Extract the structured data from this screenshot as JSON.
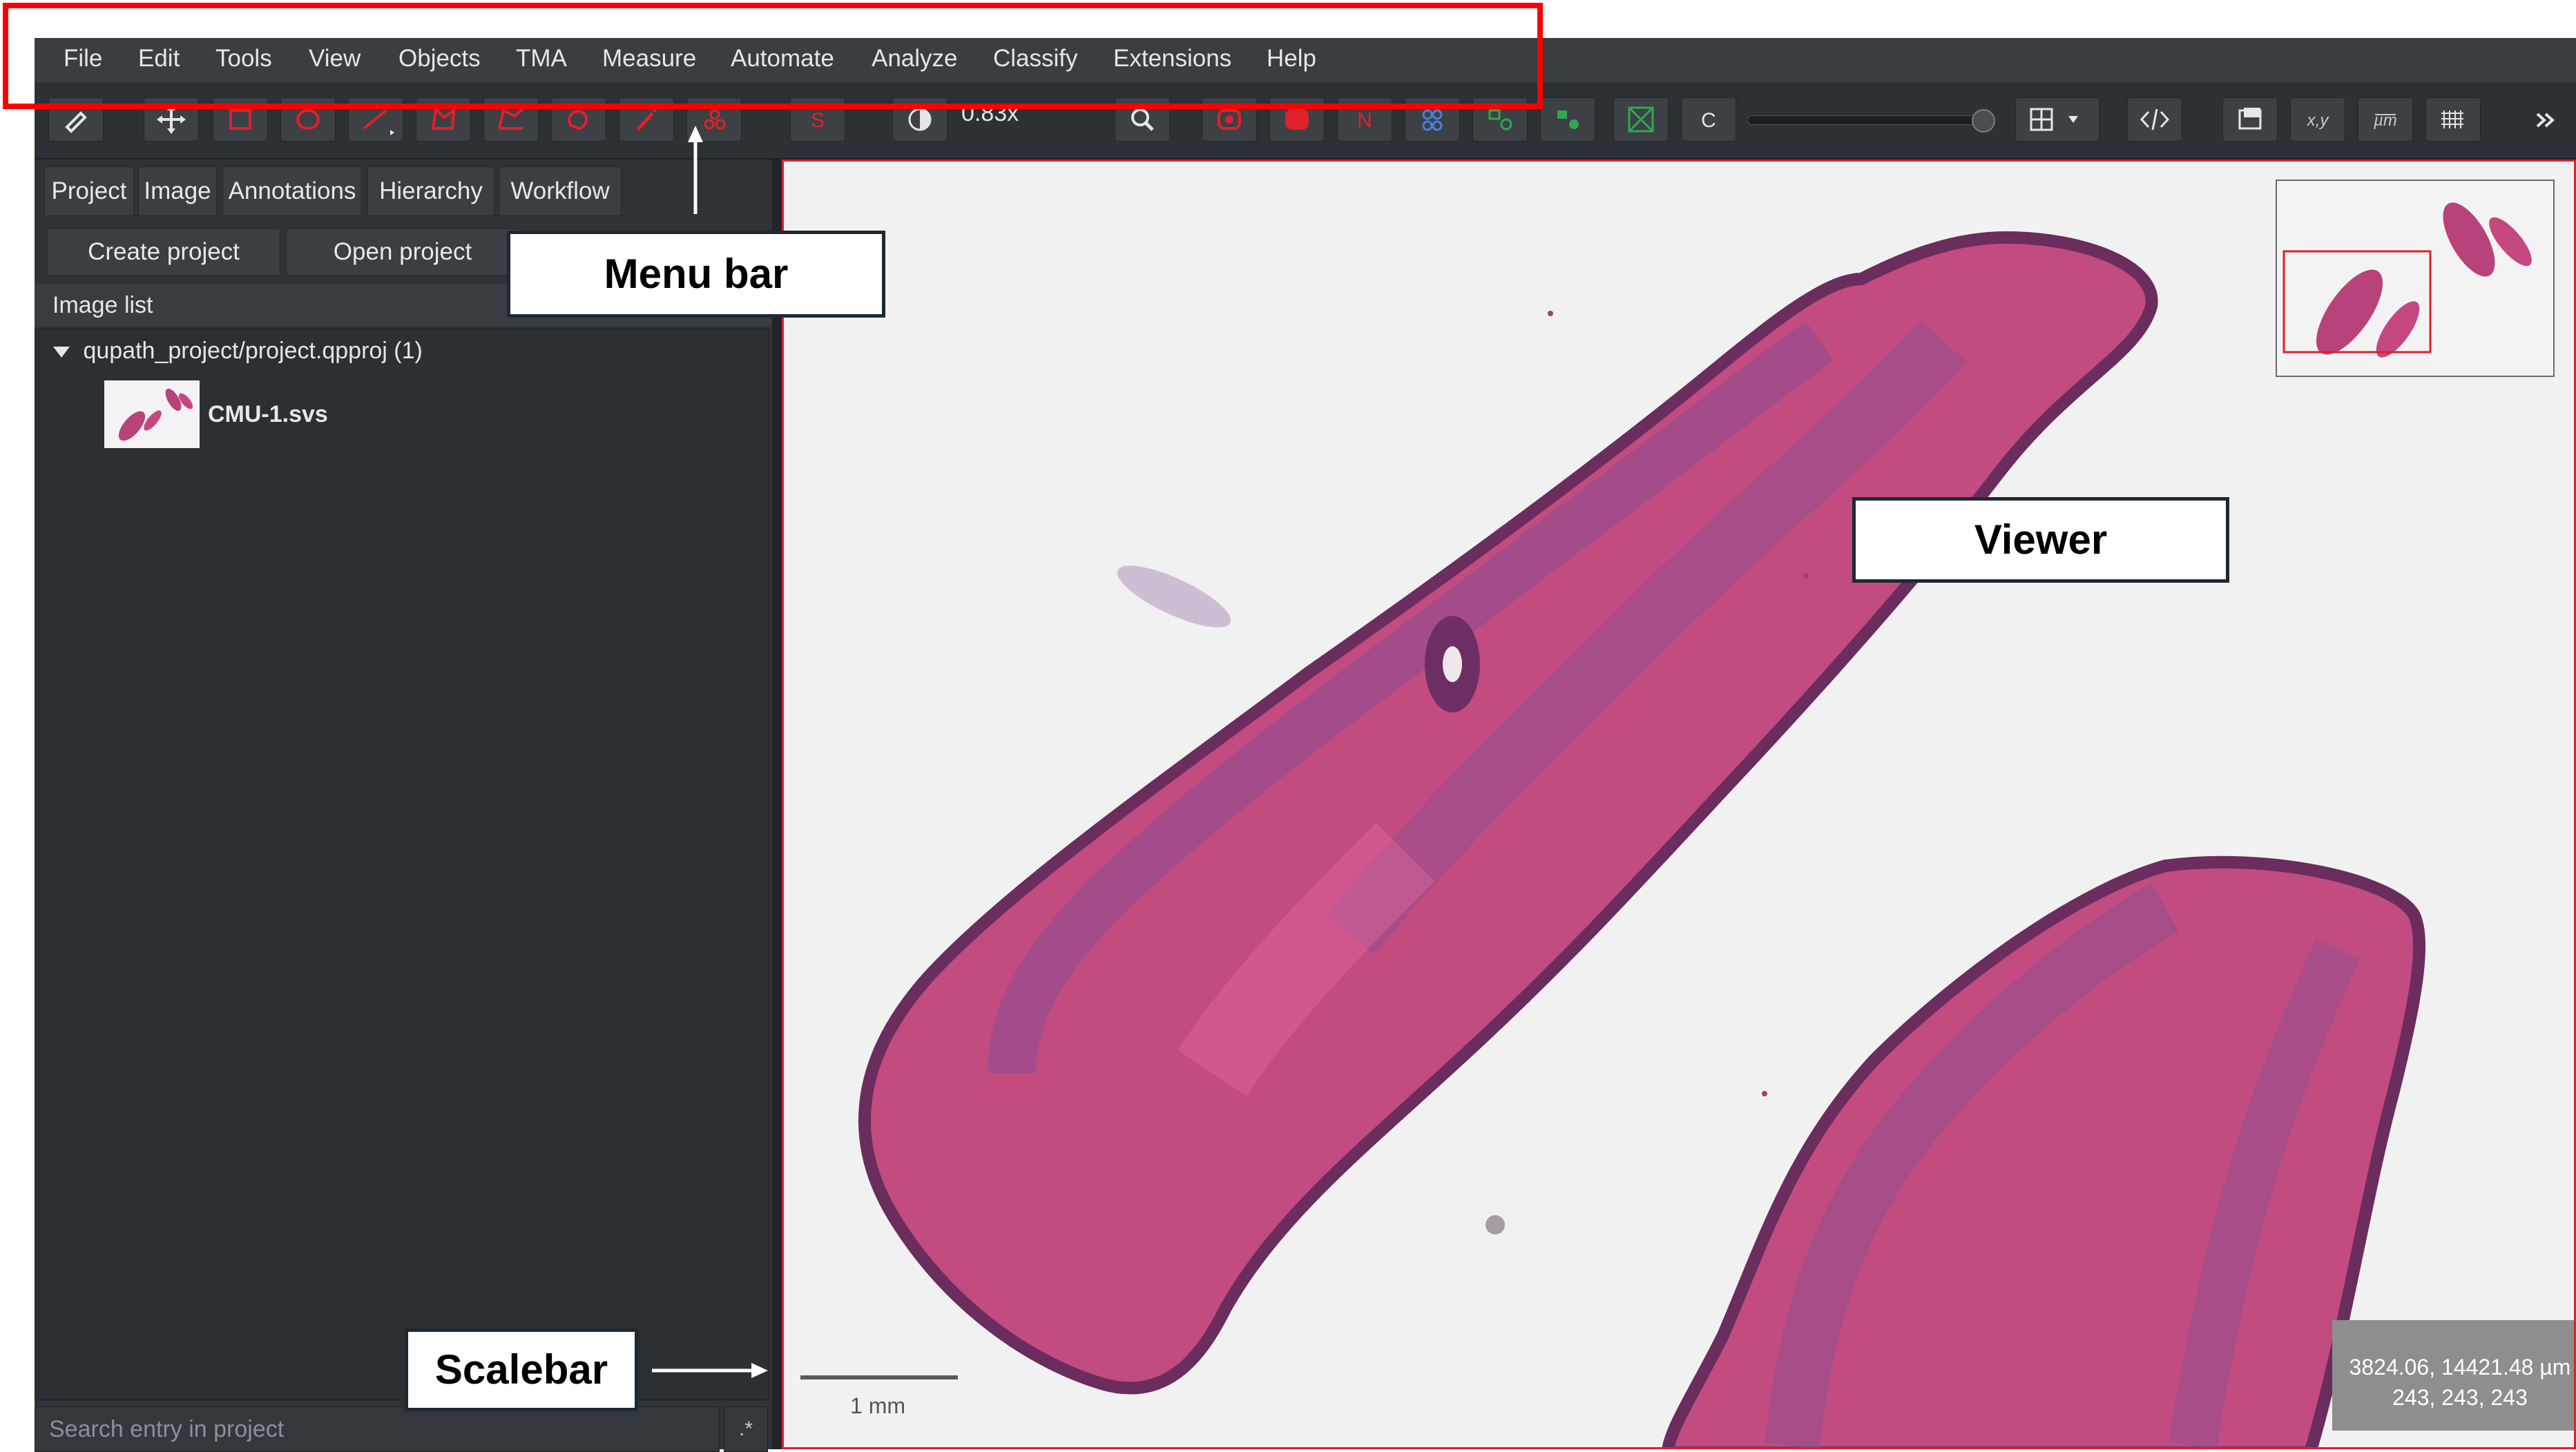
{
  "menu": {
    "items": [
      "File",
      "Edit",
      "Tools",
      "View",
      "Objects",
      "TMA",
      "Measure",
      "Automate",
      "Analyze",
      "Classify",
      "Extensions",
      "Help"
    ]
  },
  "toolbar": {
    "zoom": "0.83x",
    "c_label": "C",
    "icons": [
      "pen-tool",
      "move",
      "rectangle",
      "ellipse",
      "line",
      "polygon",
      "polyline",
      "brush",
      "wand",
      "points",
      "selection",
      "contrast",
      "zoom",
      "annotations-show",
      "fill",
      "names",
      "tma-grid",
      "detections",
      "detection-fill",
      "cell-boundaries",
      "zoom-to-fit",
      "c-toggle",
      "opacity-slider",
      "grid",
      "script",
      "overlay",
      "xy",
      "microns",
      "pixel-grid",
      "more"
    ]
  },
  "left": {
    "tabs": [
      "Project",
      "Image",
      "Annotations",
      "Hierarchy",
      "Workflow"
    ],
    "create_project": "Create project",
    "open_project": "Open project",
    "image_list": "Image list",
    "project_path": "qupath_project/project.qpproj (1)",
    "image_name": "CMU-1.svs",
    "search_placeholder": "Search entry in project",
    "search_option": ".*"
  },
  "viewer": {
    "scalebar": "1 mm",
    "coord_line1": "3824.06, 14421.48 µm",
    "coord_line2": "243, 243, 243"
  },
  "callouts": {
    "menu_bar": "Menu bar",
    "viewer": "Viewer",
    "scalebar": "Scalebar"
  },
  "colors": {
    "highlight": "#ff0000",
    "tissue": "#c0457c",
    "accent_red": "#e0202c"
  }
}
